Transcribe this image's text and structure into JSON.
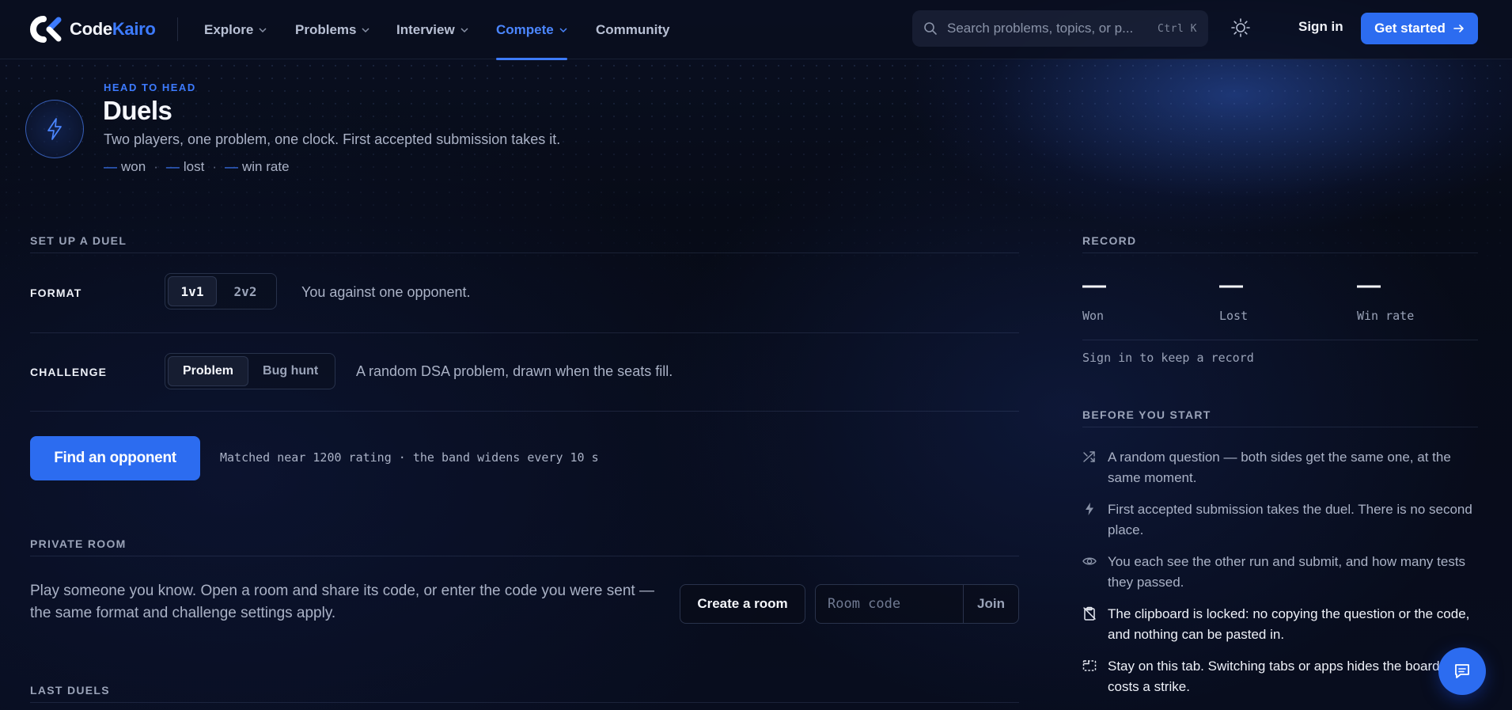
{
  "nav": {
    "brand_prefix": "Code",
    "brand_suffix": "Kairo",
    "items": [
      {
        "label": "Explore"
      },
      {
        "label": "Problems"
      },
      {
        "label": "Interview"
      },
      {
        "label": "Compete"
      },
      {
        "label": "Community"
      }
    ],
    "active": "Compete",
    "search_placeholder": "Search problems, topics, or p...",
    "search_shortcut": "Ctrl K",
    "sign_in": "Sign in",
    "get_started": "Get started"
  },
  "header": {
    "eyebrow": "HEAD TO HEAD",
    "title": "Duels",
    "subtitle": "Two players, one problem, one clock. First accepted submission takes it.",
    "stats": [
      {
        "value": "—",
        "label": "won"
      },
      {
        "value": "—",
        "label": "lost"
      },
      {
        "value": "—",
        "label": "win rate"
      }
    ]
  },
  "setup": {
    "section_title": "SET UP A DUEL",
    "format": {
      "label": "FORMAT",
      "options": [
        "1v1",
        "2v2"
      ],
      "selected": "1v1",
      "description": "You against one opponent."
    },
    "challenge": {
      "label": "CHALLENGE",
      "options": [
        "Problem",
        "Bug hunt"
      ],
      "selected": "Problem",
      "description": "A random DSA problem, drawn when the seats fill."
    },
    "find_button": "Find an opponent",
    "match_note": "Matched near 1200 rating · the band widens every 10 s"
  },
  "private_room": {
    "section_title": "PRIVATE ROOM",
    "description": "Play someone you know. Open a room and share its code, or enter the code you were sent — the same format and challenge settings apply.",
    "create_button": "Create a room",
    "code_placeholder": "Room code",
    "join_button": "Join"
  },
  "last_duels": {
    "section_title": "LAST DUELS"
  },
  "record": {
    "section_title": "RECORD",
    "items": [
      {
        "value": "—",
        "label": "Won"
      },
      {
        "value": "—",
        "label": "Lost"
      },
      {
        "value": "—",
        "label": "Win rate"
      }
    ],
    "note": "Sign in to keep a record"
  },
  "before_start": {
    "section_title": "BEFORE YOU START",
    "rules": [
      {
        "icon": "shuffle-icon",
        "text": "A random question — both sides get the same one, at the same moment."
      },
      {
        "icon": "bolt-icon",
        "text": "First accepted submission takes the duel. There is no second place."
      },
      {
        "icon": "eye-icon",
        "text": "You each see the other run and submit, and how many tests they passed."
      },
      {
        "icon": "clipboard-off-icon",
        "text": "The clipboard is locked: no copying the question or the code, and nothing can be pasted in."
      },
      {
        "icon": "tab-icon",
        "text": "Stay on this tab. Switching tabs or apps hides the board and costs a strike."
      }
    ]
  },
  "colors": {
    "accent": "#2c6cf0",
    "accent_text": "#3d7bff",
    "background": "#070b17"
  }
}
